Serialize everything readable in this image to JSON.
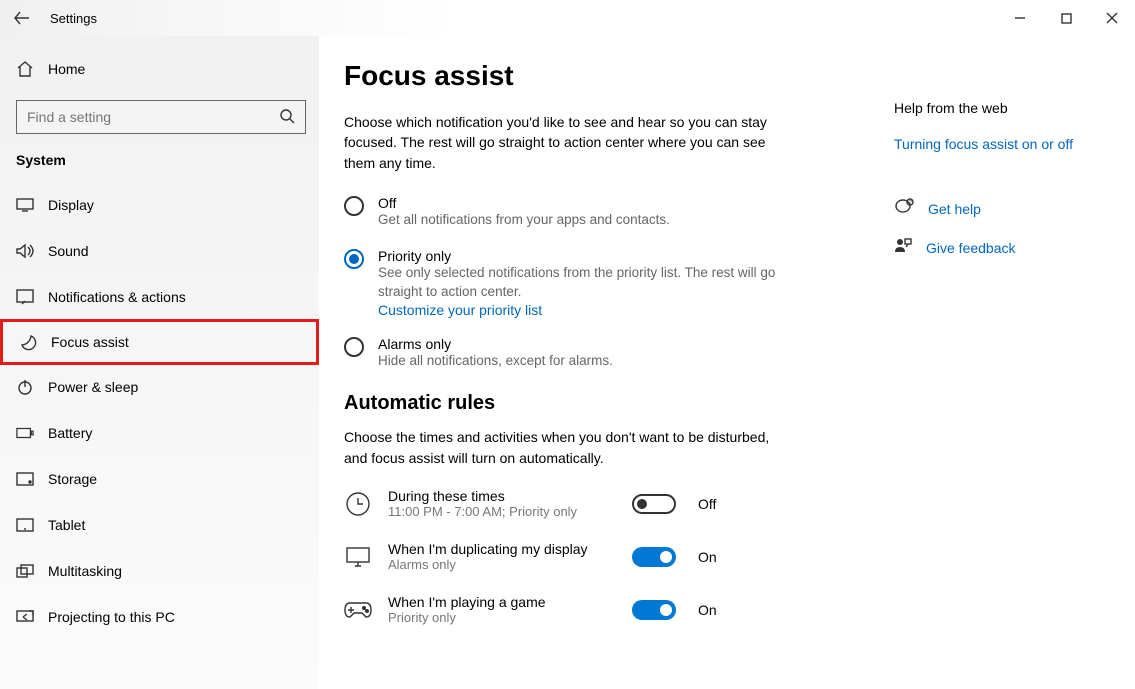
{
  "window": {
    "title": "Settings"
  },
  "sidebar": {
    "home": "Home",
    "search_placeholder": "Find a setting",
    "section": "System",
    "items": [
      {
        "label": "Display"
      },
      {
        "label": "Sound"
      },
      {
        "label": "Notifications & actions"
      },
      {
        "label": "Focus assist"
      },
      {
        "label": "Power & sleep"
      },
      {
        "label": "Battery"
      },
      {
        "label": "Storage"
      },
      {
        "label": "Tablet"
      },
      {
        "label": "Multitasking"
      },
      {
        "label": "Projecting to this PC"
      }
    ]
  },
  "page": {
    "title": "Focus assist",
    "description": "Choose which notification you'd like to see and hear so you can stay focused. The rest will go straight to action center where you can see them any time.",
    "options": {
      "off": {
        "label": "Off",
        "sub": "Get all notifications from your apps and contacts."
      },
      "priority": {
        "label": "Priority only",
        "sub": "See only selected notifications from the priority list. The rest will go straight to action center.",
        "link": "Customize your priority list"
      },
      "alarms": {
        "label": "Alarms only",
        "sub": "Hide all notifications, except for alarms."
      }
    },
    "rules": {
      "heading": "Automatic rules",
      "description": "Choose the times and activities when you don't want to be disturbed, and focus assist will turn on automatically.",
      "items": [
        {
          "title": "During these times",
          "sub": "11:00 PM - 7:00 AM; Priority only",
          "state": "Off",
          "on": false
        },
        {
          "title": "When I'm duplicating my display",
          "sub": "Alarms only",
          "state": "On",
          "on": true
        },
        {
          "title": "When I'm playing a game",
          "sub": "Priority only",
          "state": "On",
          "on": true
        }
      ]
    }
  },
  "help": {
    "heading": "Help from the web",
    "link1": "Turning focus assist on or off",
    "get_help": "Get help",
    "feedback": "Give feedback"
  }
}
